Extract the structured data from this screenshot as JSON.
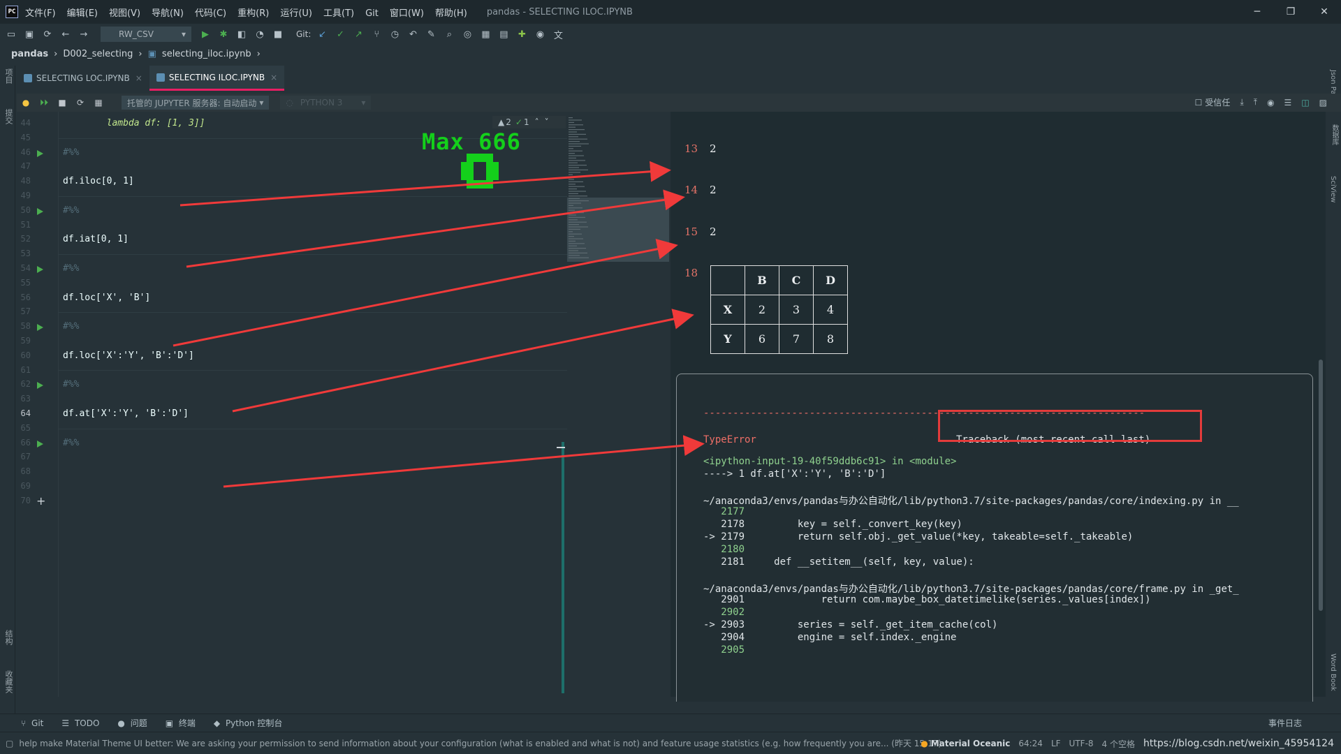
{
  "titlebar": {
    "menu": [
      "文件(F)",
      "编辑(E)",
      "视图(V)",
      "导航(N)",
      "代码(C)",
      "重构(R)",
      "运行(U)",
      "工具(T)",
      "Git",
      "窗口(W)",
      "帮助(H)"
    ],
    "title": "pandas - SELECTING ILOC.IPYNB",
    "logo": "PC"
  },
  "toolbar": {
    "run_config": "RW_CSV",
    "git_label": "Git:"
  },
  "breadcrumb": [
    "pandas",
    "D002_selecting",
    "selecting_iloc.ipynb"
  ],
  "tabs": [
    {
      "label": "SELECTING LOC.IPYNB",
      "active": false
    },
    {
      "label": "SELECTING ILOC.IPYNB",
      "active": true
    }
  ],
  "nbtoolbar": {
    "server": "托管的 JUPYTER 服务器: 自动启动",
    "kernel": "PYTHON 3",
    "trusted": "受信任"
  },
  "inspection": {
    "warnings": "2",
    "checks": "1"
  },
  "overlay_text": "Max 666",
  "left_strip": [
    "项目",
    "提交",
    "结构",
    "收藏夹"
  ],
  "right_strip": [
    "Json Parser",
    "数据库",
    "SciView",
    "Word Book"
  ],
  "editor": {
    "lines": [
      {
        "n": "44",
        "code": "        lambda df: [1, 3]]",
        "run": false
      },
      {
        "n": "45",
        "code": "",
        "run": false
      },
      {
        "n": "46",
        "code": "#%%",
        "run": true
      },
      {
        "n": "47",
        "code": "",
        "run": false
      },
      {
        "n": "48",
        "code": "df.iloc[0, 1]",
        "run": false
      },
      {
        "n": "49",
        "code": "",
        "run": false
      },
      {
        "n": "50",
        "code": "#%%",
        "run": true
      },
      {
        "n": "51",
        "code": "",
        "run": false
      },
      {
        "n": "52",
        "code": "df.iat[0, 1]",
        "run": false
      },
      {
        "n": "53",
        "code": "",
        "run": false
      },
      {
        "n": "54",
        "code": "#%%",
        "run": true
      },
      {
        "n": "55",
        "code": "",
        "run": false
      },
      {
        "n": "56",
        "code": "df.loc['X', 'B']",
        "run": false
      },
      {
        "n": "57",
        "code": "",
        "run": false
      },
      {
        "n": "58",
        "code": "#%%",
        "run": true
      },
      {
        "n": "59",
        "code": "",
        "run": false
      },
      {
        "n": "60",
        "code": "df.loc['X':'Y', 'B':'D']",
        "run": false
      },
      {
        "n": "61",
        "code": "",
        "run": false
      },
      {
        "n": "62",
        "code": "#%%",
        "run": true
      },
      {
        "n": "63",
        "code": "",
        "run": false
      },
      {
        "n": "64",
        "code": "df.at['X':'Y', 'B':'D']",
        "run": false
      },
      {
        "n": "65",
        "code": "",
        "run": false
      },
      {
        "n": "66",
        "code": "#%%",
        "run": true
      },
      {
        "n": "67",
        "code": "",
        "run": false
      },
      {
        "n": "68",
        "code": "",
        "run": false
      },
      {
        "n": "69",
        "code": "",
        "run": false
      },
      {
        "n": "70",
        "code": "",
        "run": false
      }
    ]
  },
  "output": {
    "cells": [
      {
        "num": "13",
        "value": "2"
      },
      {
        "num": "14",
        "value": "2"
      },
      {
        "num": "15",
        "value": "2"
      },
      {
        "num": "18",
        "value": ""
      }
    ],
    "table": {
      "columns": [
        "",
        "B",
        "C",
        "D"
      ],
      "rows": [
        [
          "X",
          "2",
          "3",
          "4"
        ],
        [
          "Y",
          "6",
          "7",
          "8"
        ]
      ]
    },
    "traceback": {
      "dashes": "---------------------------------------------------------------------------",
      "error": "TypeError",
      "header": "Traceback (most recent call last)",
      "lines": [
        {
          "text": "<ipython-input-19-40f59ddb6c91> in <module>",
          "style": "green"
        },
        {
          "text": "----> 1 df.at['X':'Y', 'B':'D']",
          "style": "plain"
        },
        {
          "text": "",
          "style": "plain"
        },
        {
          "text": "~/anaconda3/envs/pandas与办公自动化/lib/python3.7/site-packages/pandas/core/indexing.py in __",
          "style": "plain"
        },
        {
          "text": "   2177",
          "style": "green"
        },
        {
          "text": "   2178         key = self._convert_key(key)",
          "style": "plain"
        },
        {
          "text": "-> 2179         return self.obj._get_value(*key, takeable=self._takeable)",
          "style": "plain"
        },
        {
          "text": "   2180",
          "style": "green"
        },
        {
          "text": "   2181     def __setitem__(self, key, value):",
          "style": "plain"
        },
        {
          "text": "",
          "style": "plain"
        },
        {
          "text": "~/anaconda3/envs/pandas与办公自动化/lib/python3.7/site-packages/pandas/core/frame.py in _get_",
          "style": "plain"
        },
        {
          "text": "   2901             return com.maybe_box_datetimelike(series._values[index])",
          "style": "plain"
        },
        {
          "text": "   2902",
          "style": "green"
        },
        {
          "text": "-> 2903         series = self._get_item_cache(col)",
          "style": "plain"
        },
        {
          "text": "   2904         engine = self.index._engine",
          "style": "plain"
        },
        {
          "text": "   2905",
          "style": "green"
        }
      ]
    }
  },
  "bottom_tools": [
    "Git",
    "TODO",
    "问题",
    "终端",
    "Python 控制台"
  ],
  "event_log": "事件日志",
  "status": {
    "message": "help make Material Theme UI better: We are asking your permission to send information about your configuration (what is enabled and what is not) and feature usage statistics (e.g. how frequently you are... (昨天 15:17)",
    "theme": "Material Oceanic",
    "position": "64:24",
    "line_sep": "LF",
    "encoding": "UTF-8",
    "indent": "4 个空格",
    "watermark": "https://blog.csdn.net/weixin_45954124"
  },
  "colors": {
    "accent": "#e91e63",
    "arrow": "#f03a3a",
    "run": "#4caf50",
    "overlay": "#14d01b"
  }
}
